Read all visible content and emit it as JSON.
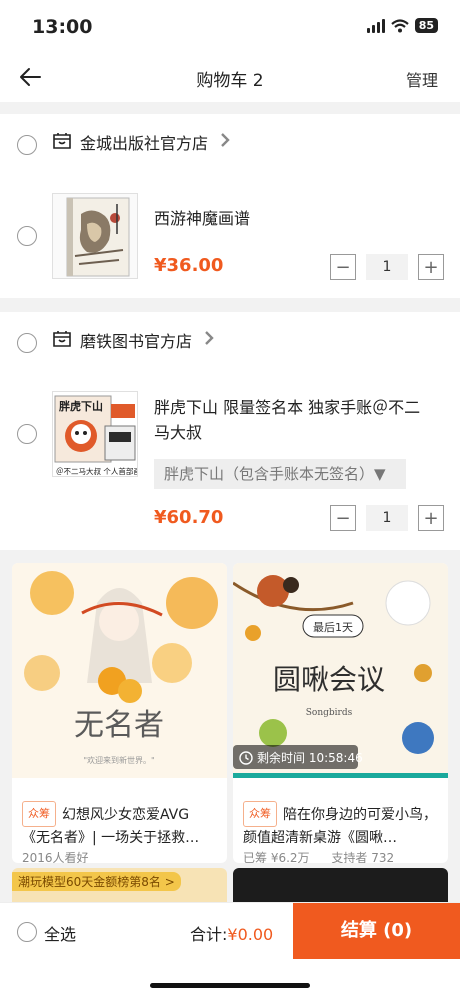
{
  "status": {
    "time": "13:00",
    "battery": "85"
  },
  "nav": {
    "title": "购物车 2",
    "manage": "管理"
  },
  "shops": [
    {
      "name": "金城出版社官方店",
      "item": {
        "title": "西游神魔画谱",
        "price": "¥36.00",
        "qty": "1"
      }
    },
    {
      "name": "磨铁图书官方店",
      "item": {
        "title_line1": "胖虎下山 限量签名本 独家手账＠不二",
        "title_line2": "马大叔",
        "variant": "胖虎下山（包含手账本无签名）▼",
        "price": "¥60.70",
        "qty": "1",
        "cover_caption": "＠不二马大叔 个人首部画集",
        "cover_title": "胖虎下山"
      }
    }
  ],
  "recommend": [
    {
      "tag": "众筹",
      "text": "幻想风少女恋爱AVG《无名者》| 一场关于拯救…",
      "meta": "2016人看好",
      "art_title": "无名者",
      "art_sub": "\"欢迎来到新世界。\""
    },
    {
      "tag": "众筹",
      "text": "陪在你身边的可爱小鸟，颜值超清新桌游《圆啾…",
      "meta_raised": "已筹 ¥6.2万",
      "meta_backers": "支持者 732",
      "countdown": "剩余时间 10:58:46",
      "art_title": "圆啾会议",
      "art_badge": "最后1天",
      "art_sub": "Songbirds"
    }
  ],
  "peek": {
    "banner": "潮玩模型60天金额榜第8名 >"
  },
  "bottom": {
    "select_all": "全选",
    "total_label": "合计:",
    "total_value": "¥0.00",
    "checkout": "结算 (0)"
  },
  "colors": {
    "accent": "#f05a1f",
    "teal": "#1aa99c"
  }
}
